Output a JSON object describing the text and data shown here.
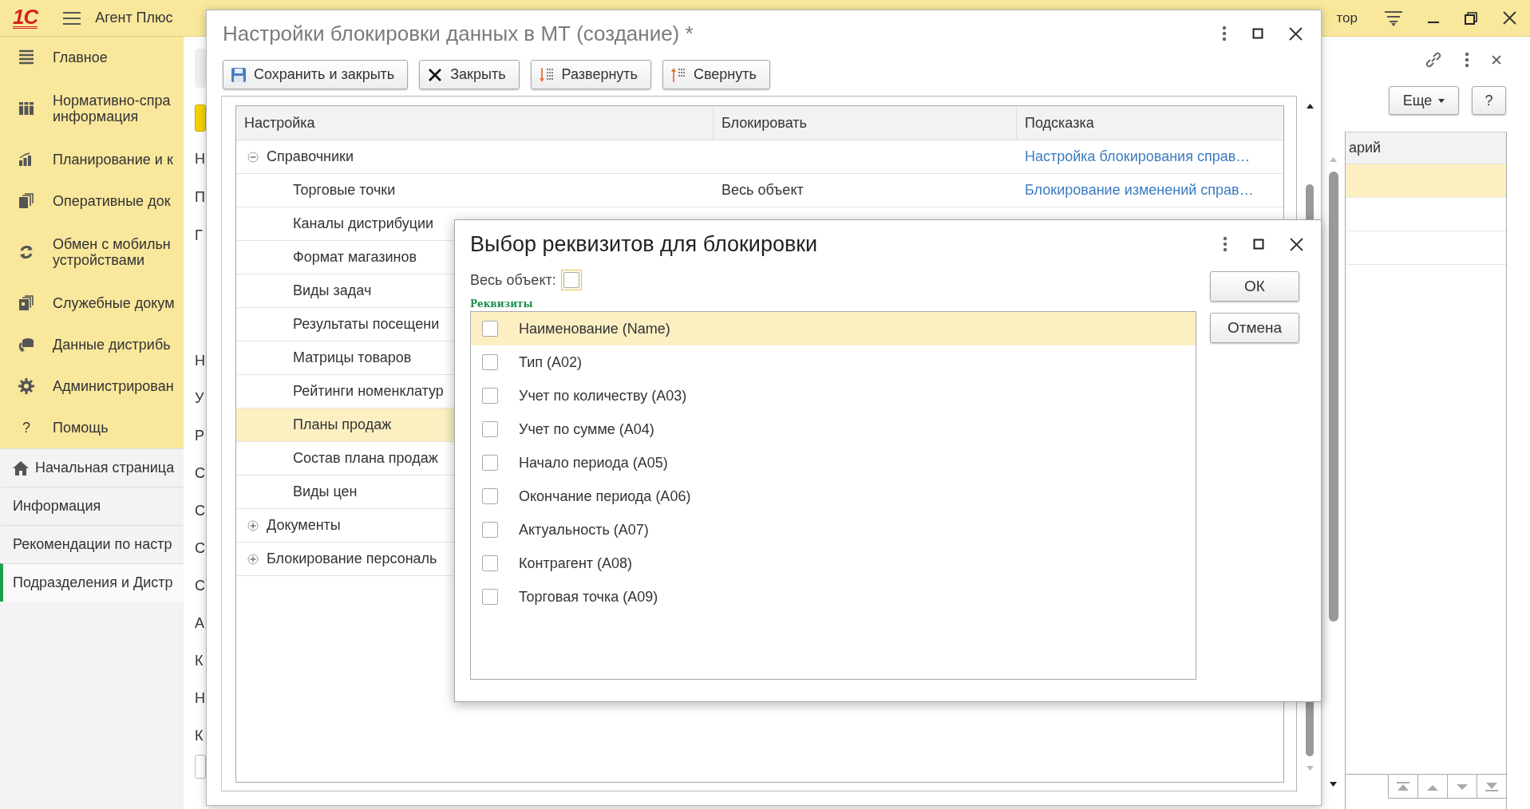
{
  "app_header": {
    "logo": "1С",
    "title": "Агент Плюс",
    "user": "тор"
  },
  "sections": [
    {
      "lines": [
        "Главное"
      ]
    },
    {
      "lines": [
        "Нормативно-спра",
        "информация"
      ]
    },
    {
      "lines": [
        "Планирование и к"
      ]
    },
    {
      "lines": [
        "Оперативные док"
      ]
    },
    {
      "lines": [
        "Обмен с мобильн",
        "устройствами"
      ]
    },
    {
      "lines": [
        "Служебные докум"
      ]
    },
    {
      "lines": [
        "Данные дистрибь"
      ]
    },
    {
      "lines": [
        "Администрирован"
      ]
    },
    {
      "lines": [
        "Помощь"
      ],
      "glyph": "?"
    }
  ],
  "open_tabs": [
    {
      "kind": "home",
      "label": "Начальная страница",
      "selected": false
    },
    {
      "kind": "page",
      "label": "Информация",
      "selected": false
    },
    {
      "kind": "page",
      "label": "Рекомендации по настр",
      "selected": false
    },
    {
      "kind": "page",
      "label": "Подразделения и Дистр",
      "selected": true
    }
  ],
  "background_form": {
    "labels_upper": [
      "Н",
      "П",
      "Г"
    ],
    "labels_lower": [
      "Н",
      "У",
      "Р",
      "С",
      "С",
      "С",
      "С",
      "А",
      "К",
      "Н",
      "К"
    ],
    "more_button": "Еще",
    "help_button": "?",
    "table": {
      "column": "арий",
      "rows": [
        {
          "selected": true
        },
        {
          "selected": false
        },
        {
          "selected": false
        }
      ]
    }
  },
  "main_window": {
    "title": "Настройки блокировки данных в МТ (создание) *",
    "toolbar": [
      {
        "label": "Сохранить и закрыть"
      },
      {
        "label": "Закрыть"
      },
      {
        "label": "Развернуть"
      },
      {
        "label": "Свернуть"
      }
    ],
    "tree": {
      "columns": [
        "Настройка",
        "Блокировать",
        "Подсказка"
      ],
      "rows": [
        {
          "label": "Справочники",
          "expanded": true,
          "selected": false,
          "hint": "Настройка блокирования справ…",
          "children": [
            {
              "label": "Торговые точки",
              "block": "Весь объект",
              "hint": "Блокирование изменений справ…",
              "selected": false
            },
            {
              "label": "Каналы дистрибуции",
              "selected": false
            },
            {
              "label": "Формат магазинов",
              "selected": false
            },
            {
              "label": "Виды задач",
              "selected": false
            },
            {
              "label": "Результаты посещени",
              "selected": false
            },
            {
              "label": "Матрицы товаров",
              "selected": false
            },
            {
              "label": "Рейтинги номенклатур",
              "selected": false
            },
            {
              "label": "Планы продаж",
              "selected": true
            },
            {
              "label": "Состав плана продаж",
              "selected": false
            },
            {
              "label": "Виды цен",
              "selected": false
            }
          ]
        },
        {
          "label": "Документы",
          "expanded": false,
          "selected": false
        },
        {
          "label": "Блокирование персональ",
          "expanded": false,
          "selected": false
        }
      ]
    }
  },
  "dialog": {
    "title": "Выбор реквизитов для блокировки",
    "whole_object": {
      "label": "Весь объект:",
      "checked": false,
      "focused": true
    },
    "list_title": "Реквизиты",
    "attributes": [
      {
        "label": "Наименование (Name)",
        "checked": false,
        "selected": true
      },
      {
        "label": "Тип (A02)",
        "checked": false,
        "selected": false
      },
      {
        "label": "Учет по количеству (A03)",
        "checked": false,
        "selected": false
      },
      {
        "label": "Учет по сумме (A04)",
        "checked": false,
        "selected": false
      },
      {
        "label": "Начало периода (A05)",
        "checked": false,
        "selected": false
      },
      {
        "label": "Окончание периода (A06)",
        "checked": false,
        "selected": false
      },
      {
        "label": "Актуальность (A07)",
        "checked": false,
        "selected": false
      },
      {
        "label": "Контрагент (A08)",
        "checked": false,
        "selected": false
      },
      {
        "label": "Торговая точка (A09)",
        "checked": false,
        "selected": false
      }
    ],
    "buttons": [
      "ОК",
      "Отмена"
    ]
  }
}
